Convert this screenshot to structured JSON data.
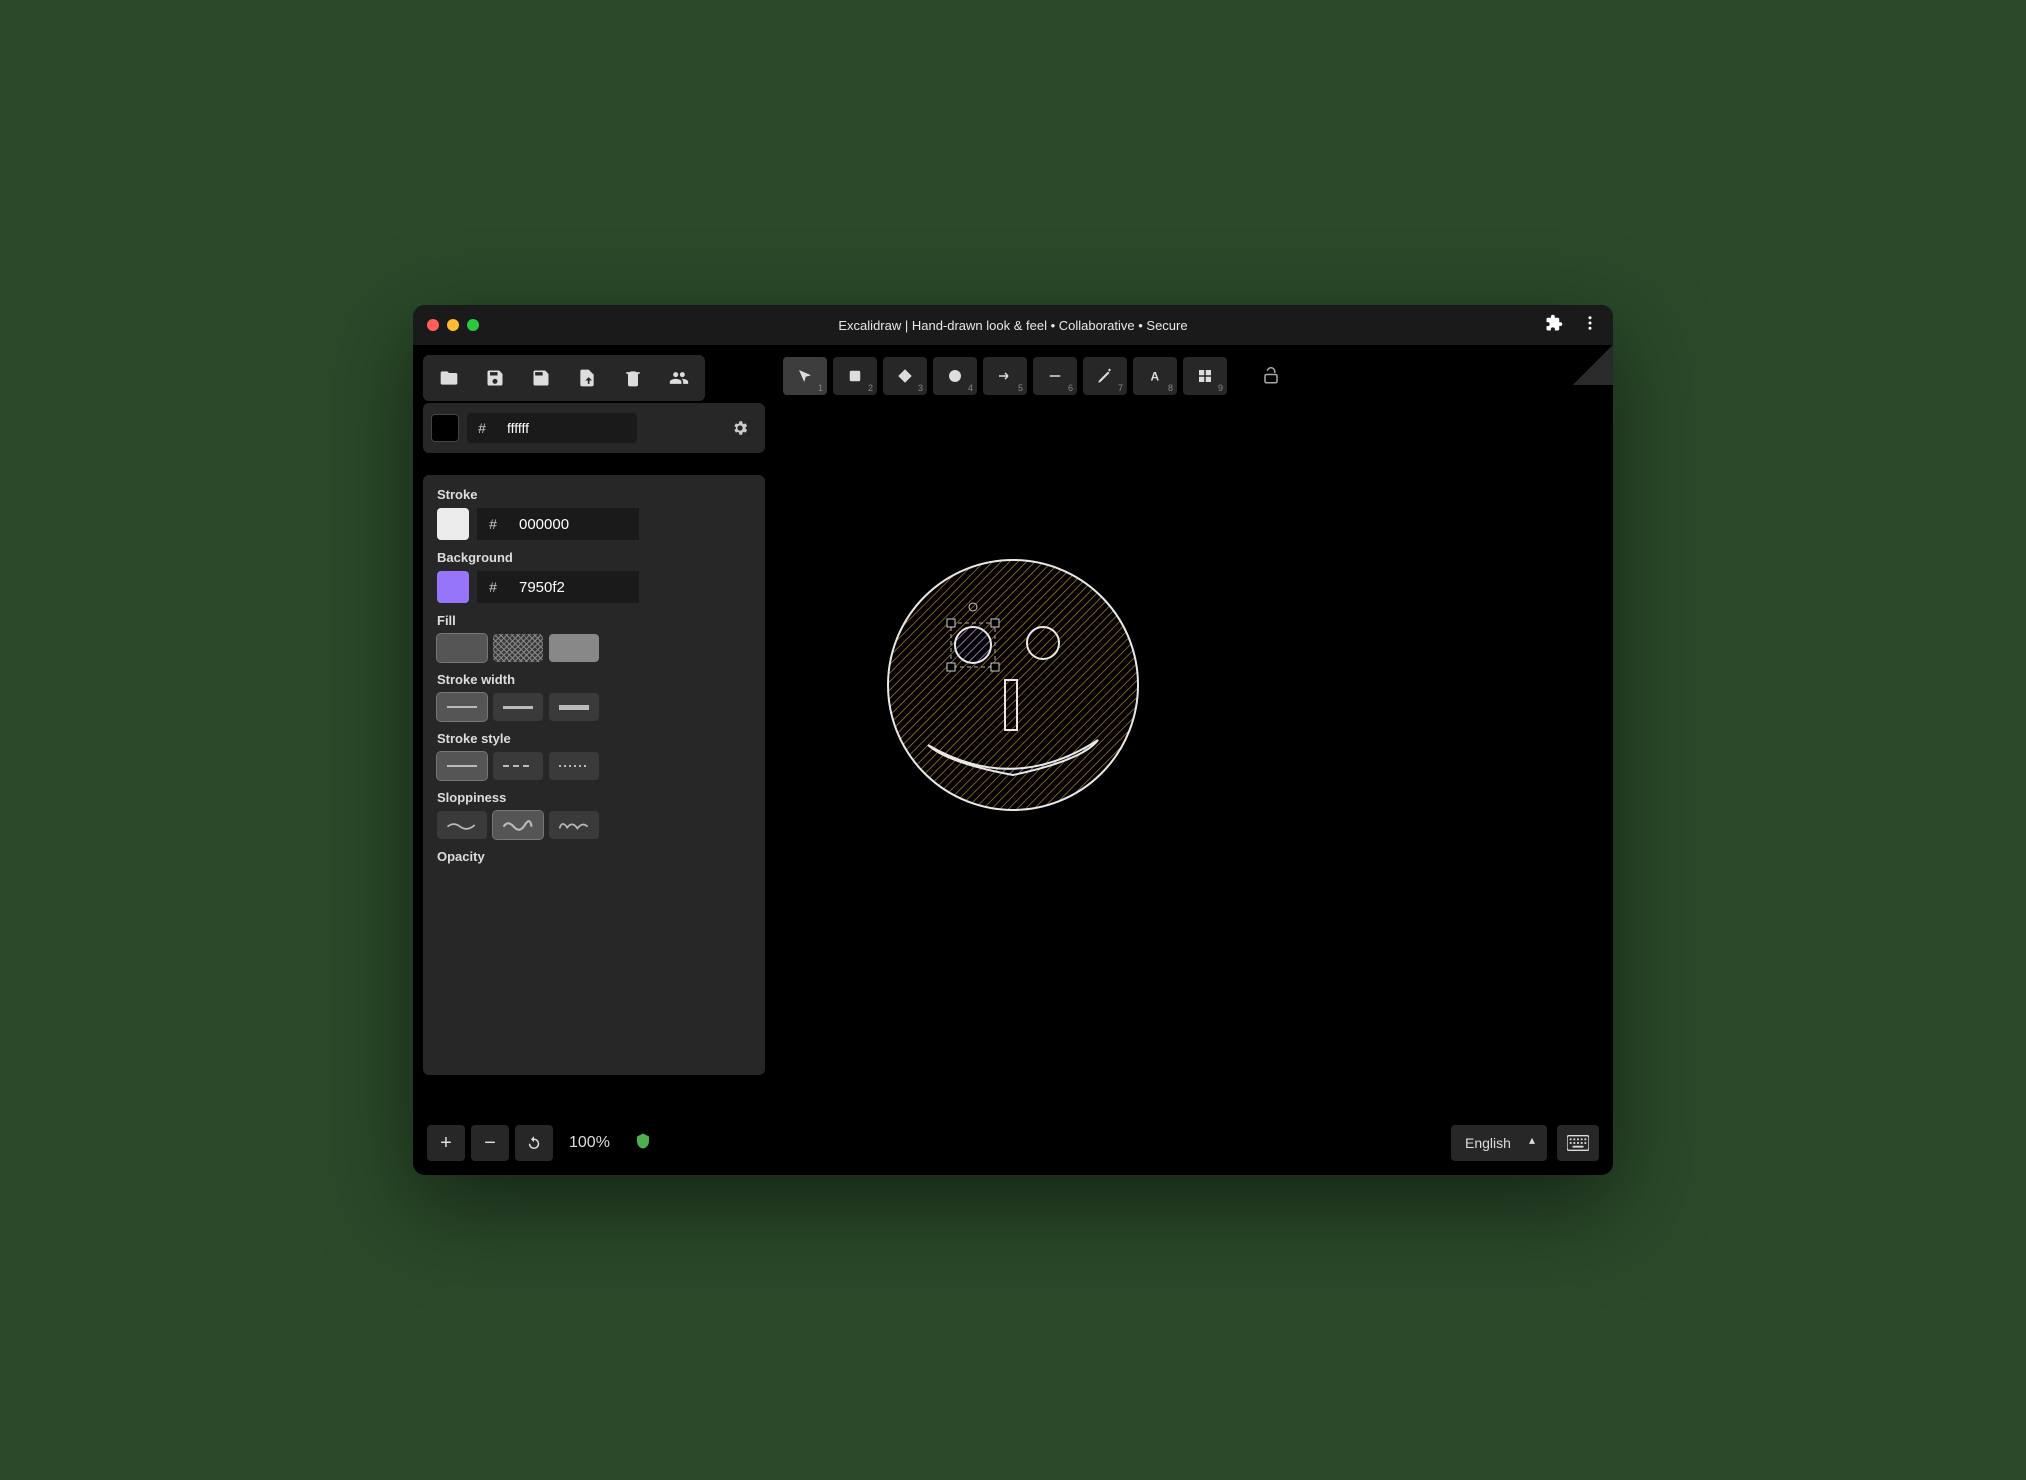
{
  "window": {
    "title": "Excalidraw | Hand-drawn look & feel • Collaborative • Secure"
  },
  "toolbar": {
    "file": [
      "open",
      "save",
      "export",
      "share",
      "delete",
      "collaborate"
    ]
  },
  "canvasColor": {
    "hash": "#",
    "hex": "ffffff"
  },
  "shapes": [
    {
      "id": "select",
      "num": "1"
    },
    {
      "id": "rectangle",
      "num": "2"
    },
    {
      "id": "diamond",
      "num": "3"
    },
    {
      "id": "ellipse",
      "num": "4"
    },
    {
      "id": "arrow",
      "num": "5"
    },
    {
      "id": "line",
      "num": "6"
    },
    {
      "id": "draw",
      "num": "7"
    },
    {
      "id": "text",
      "num": "8"
    },
    {
      "id": "more",
      "num": "9"
    }
  ],
  "props": {
    "stroke_label": "Stroke",
    "stroke_hex": "000000",
    "background_label": "Background",
    "background_hex": "7950f2",
    "fill_label": "Fill",
    "stroke_width_label": "Stroke width",
    "stroke_style_label": "Stroke style",
    "sloppiness_label": "Sloppiness",
    "opacity_label": "Opacity",
    "hash": "#"
  },
  "footer": {
    "zoom": "100%",
    "language": "English"
  }
}
